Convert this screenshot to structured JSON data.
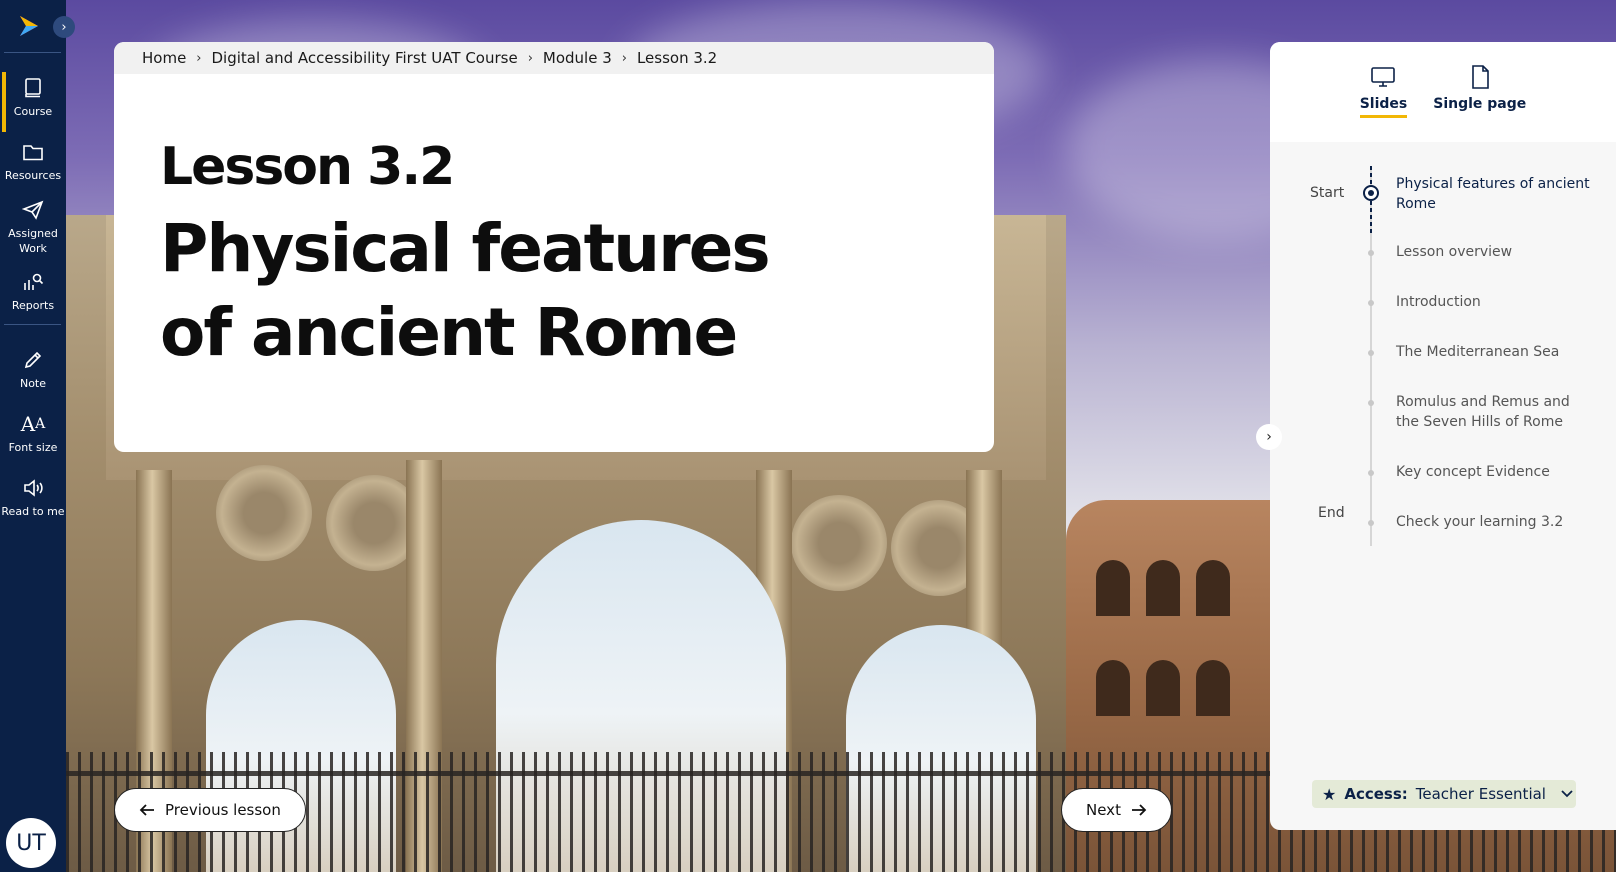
{
  "sidebar": {
    "items": [
      {
        "key": "course",
        "label": "Course",
        "icon": "book-icon",
        "active": true
      },
      {
        "key": "resources",
        "label": "Resources",
        "icon": "folder-icon",
        "active": false
      },
      {
        "key": "assigned",
        "label": "Assigned\nWork",
        "icon": "paper-plane-icon",
        "active": false
      },
      {
        "key": "reports",
        "label": "Reports",
        "icon": "reports-icon",
        "active": false
      },
      {
        "key": "note",
        "label": "Note",
        "icon": "pencil-icon",
        "active": false
      },
      {
        "key": "fontsize",
        "label": "Font size",
        "icon": "font-size-icon",
        "active": false
      },
      {
        "key": "read",
        "label": "Read to me",
        "icon": "speaker-icon",
        "active": false
      }
    ],
    "avatar_initials": "UT"
  },
  "breadcrumb": [
    "Home",
    "Digital and Accessibility First UAT Course",
    "Module 3",
    "Lesson 3.2"
  ],
  "lesson": {
    "number": "Lesson 3.2",
    "title": "Physical features of ancient Rome"
  },
  "nav": {
    "previous_label": "Previous lesson",
    "next_label": "Next"
  },
  "panel": {
    "tabs": [
      {
        "label": "Slides",
        "icon": "monitor-icon",
        "active": true
      },
      {
        "label": "Single page",
        "icon": "page-icon",
        "active": false
      }
    ],
    "start_label": "Start",
    "end_label": "End",
    "toc": [
      "Physical features of ancient Rome",
      "Lesson overview",
      "Introduction",
      "The Mediterranean Sea",
      "Romulus and Remus and the Seven Hills of Rome",
      "Key concept Evidence",
      "Check your learning 3.2"
    ],
    "access_key": "Access:",
    "access_value": "Teacher Essential"
  },
  "colors": {
    "sidebar_bg": "#0b2147",
    "accent": "#f2b705",
    "access_bg": "#e4ead7"
  }
}
